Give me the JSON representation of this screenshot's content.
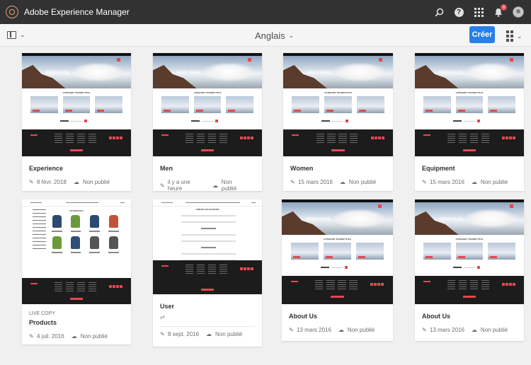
{
  "header": {
    "app_title": "Adobe Experience Manager",
    "notification_count": "8"
  },
  "toolbar": {
    "language": "Anglais",
    "create_label": "Créer"
  },
  "cards": [
    {
      "title": "Experience",
      "subtitle": "",
      "modified": "8 févr. 2018",
      "status": "Non publié",
      "thumb": "hero"
    },
    {
      "title": "Men",
      "subtitle": "",
      "modified": "il y a une heure",
      "status": "Non publié",
      "thumb": "hero"
    },
    {
      "title": "Women",
      "subtitle": "",
      "modified": "15 mars 2016",
      "status": "Non publié",
      "thumb": "hero"
    },
    {
      "title": "Equipment",
      "subtitle": "",
      "modified": "15 mars 2016",
      "status": "Non publié",
      "thumb": "hero"
    },
    {
      "title": "Products",
      "subtitle": "LIVE COPY",
      "modified": "4 juil. 2016",
      "status": "Non publié",
      "thumb": "backpacks"
    },
    {
      "title": "User",
      "subtitle": "",
      "modified": "8 sept. 2016",
      "status": "Non publié",
      "thumb": "form"
    },
    {
      "title": "About Us",
      "subtitle": "",
      "modified": "13 mars 2016",
      "status": "Non publié",
      "thumb": "hero"
    },
    {
      "title": "About Us",
      "subtitle": "",
      "modified": "13 mars 2016",
      "status": "Non publié",
      "thumb": "hero"
    }
  ],
  "thumb_text": {
    "hero_page": "HERO PAGE",
    "category_teaser": "CATEGORY TEASER TITLE",
    "backpacks": "BACKPACKS",
    "create_account": "CREATE AN ACCOUNT"
  },
  "icons": {
    "search": "search-icon",
    "help": "help-icon",
    "apps": "apps-grid-icon",
    "bell": "bell-icon",
    "avatar": "avatar",
    "rail": "rail-toggle-icon",
    "view": "view-switcher-icon",
    "edit": "pencil-icon",
    "publish": "publish-status-icon"
  },
  "colors": {
    "shell": "#323232",
    "accent": "#2680eb",
    "brand_red": "#e34850",
    "background": "#f0f0f0"
  }
}
